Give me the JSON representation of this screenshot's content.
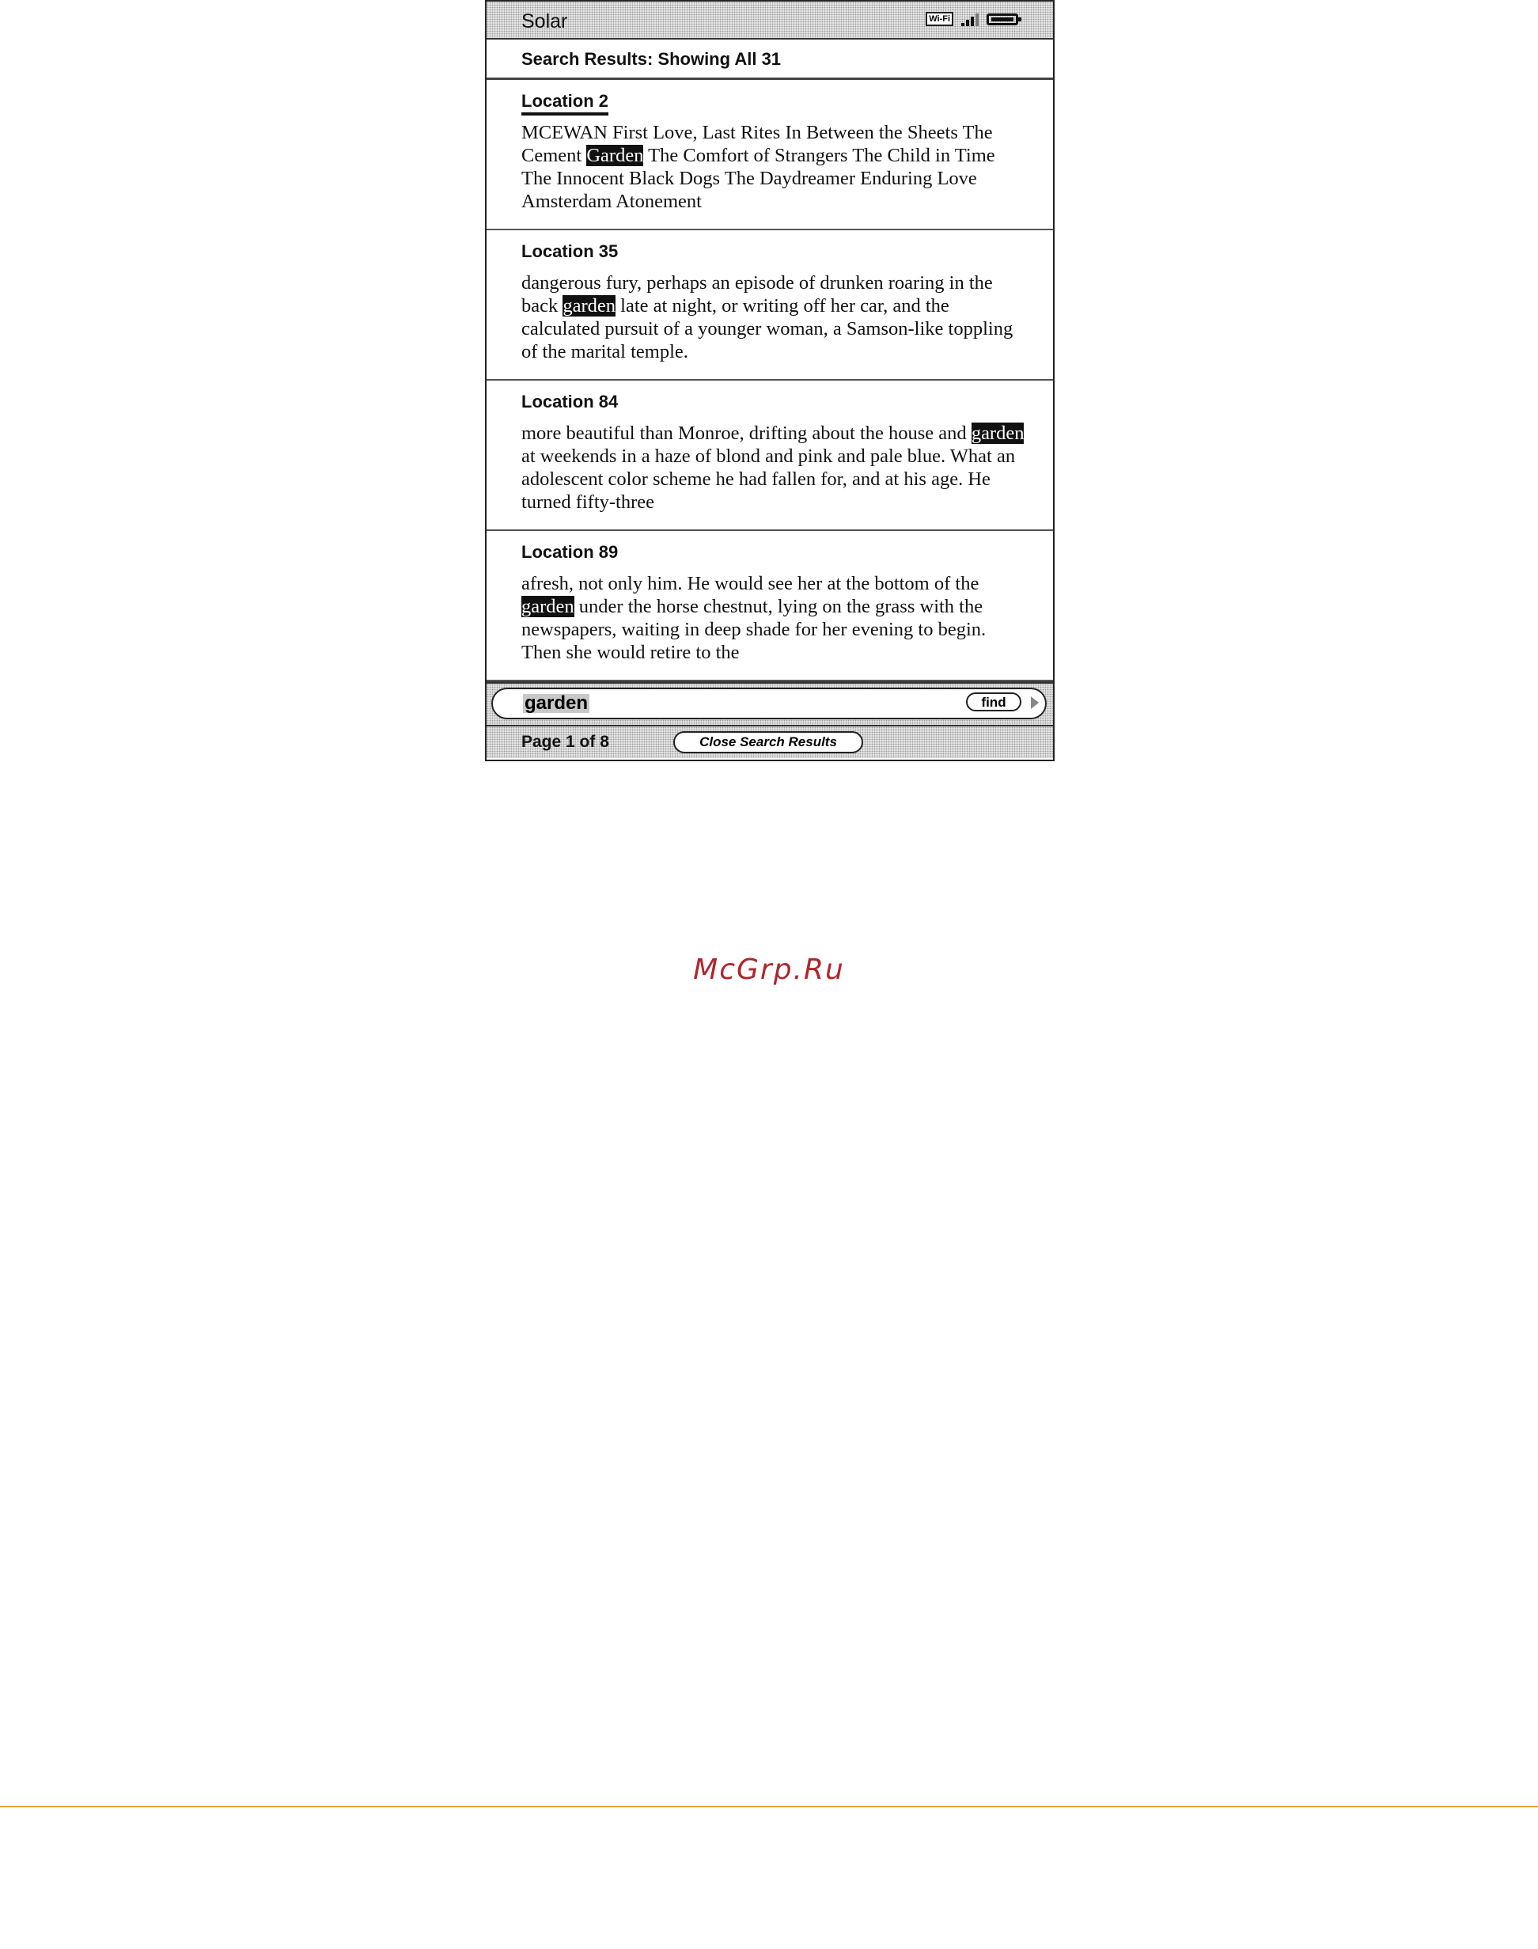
{
  "device": {
    "book_title": "Solar",
    "status_icons": [
      "wifi-icon",
      "signal-icon",
      "battery-icon"
    ],
    "wifi_label": "Wi-Fi"
  },
  "search_results": {
    "header": "Search Results: Showing All 31",
    "items": [
      {
        "location": "Location 2",
        "selected": true,
        "before": "MCEWAN First Love, Last Rites In Between the Sheets The Cement ",
        "match": "Garden",
        "after": " The Comfort of Strangers The Child in Time The Innocent Black Dogs The Daydreamer Enduring Love Amsterdam Atonement"
      },
      {
        "location": "Location 35",
        "selected": false,
        "before": "dangerous fury, perhaps an episode of drunken roaring in the back ",
        "match": "garden",
        "after": " late at night, or writing off her car, and the calculated pursuit of a younger woman, a Samson-like toppling of the marital temple."
      },
      {
        "location": "Location 84",
        "selected": false,
        "before": "more beautiful than Monroe, drifting about the house and ",
        "match": "garden",
        "after": " at weekends in a haze of blond and pink and pale blue. What an adolescent color scheme he had fallen for, and at his age. He turned fifty-three"
      },
      {
        "location": "Location 89",
        "selected": false,
        "before": "afresh, not only him. He would see her at the bottom of the ",
        "match": "garden",
        "after": " under the horse chestnut, lying on the grass with the newspapers, waiting in deep shade for her evening to begin. Then she would retire to the"
      }
    ]
  },
  "search": {
    "query": "garden",
    "find_label": "find"
  },
  "footer": {
    "page_label": "Page 1 of 8",
    "close_label": "Close Search Results"
  },
  "watermark": "McGrp.Ru",
  "colors": {
    "watermark": "#b0262d",
    "rule": "#e0a43a",
    "highlight": "#111111"
  }
}
